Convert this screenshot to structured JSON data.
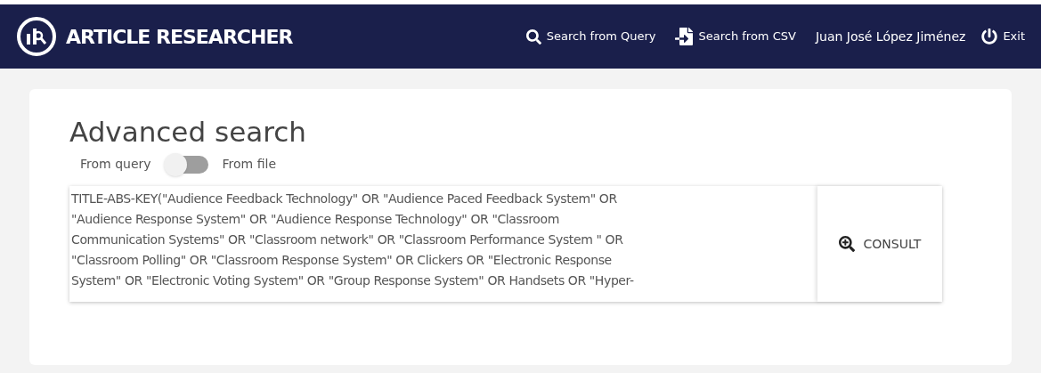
{
  "header": {
    "title": "ARTICLE RESEARCHER",
    "nav": [
      {
        "kind": "search",
        "label": "Search from Query"
      },
      {
        "kind": "import",
        "label": "Search from CSV"
      },
      {
        "kind": "user",
        "label": "Juan José López Jiménez"
      },
      {
        "kind": "exit",
        "label": "Exit"
      }
    ]
  },
  "search": {
    "title": "Advanced search",
    "toggle": {
      "left_label": "From query",
      "right_label": "From file",
      "on": false
    },
    "query_lines": [
      "TITLE-ABS-KEY(\"Audience Feedback Technology\" OR \"Audience Paced Feedback System\" OR",
      "\"Audience Response System\" OR \"Audience Response Technology\" OR \"Classroom",
      "Communication Systems\" OR \"Classroom network\" OR \"Classroom Performance System \" OR",
      "\"Classroom Polling\" OR \"Classroom Response System\" OR Clickers OR \"Electronic Response",
      "System\" OR \"Electronic Voting System\" OR \"Group Response System\" OR Handsets OR \"Hyper-"
    ],
    "button": "CONSULT"
  }
}
